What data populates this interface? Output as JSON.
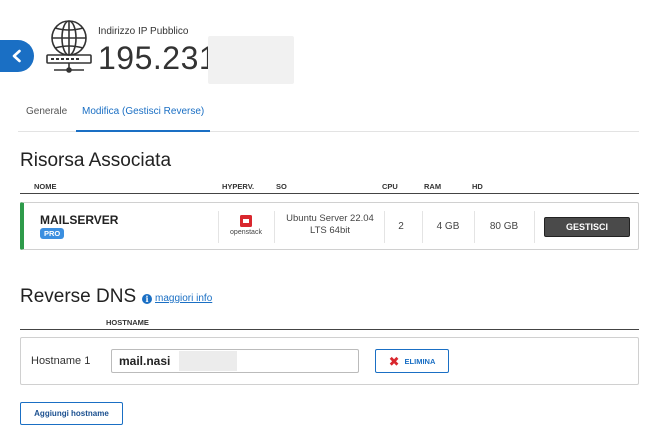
{
  "header": {
    "ip_label": "Indirizzo IP Pubblico",
    "ip_value": "195.231"
  },
  "tabs": [
    {
      "label": "Generale",
      "active": false
    },
    {
      "label": "Modifica (Gestisci Reverse)",
      "active": true
    }
  ],
  "risorsa": {
    "title": "Risorsa Associata",
    "columns": [
      "NOME",
      "HYPERV.",
      "SO",
      "CPU",
      "RAM",
      "HD"
    ],
    "server": {
      "name": "MAILSERVER",
      "badge": "PRO",
      "hypervisor": "openstack",
      "os_line1": "Ubuntu Server 22.04",
      "os_line2": "LTS 64bit",
      "cpu": "2",
      "ram": "4 GB",
      "hd": "80 GB",
      "action_label": "GESTISCI"
    }
  },
  "reverse_dns": {
    "title": "Reverse DNS",
    "info_link": "maggiori info",
    "column": "HOSTNAME",
    "entries": [
      {
        "label": "Hostname 1",
        "value": "mail.nasi",
        "delete_label": "ELIMINA"
      }
    ],
    "add_label": "Aggiungi hostname"
  },
  "colors": {
    "accent": "#1a6fc4",
    "status_green": "#2e9b4a",
    "delete_red": "#d9272e",
    "openstack_red": "#d9272e"
  }
}
